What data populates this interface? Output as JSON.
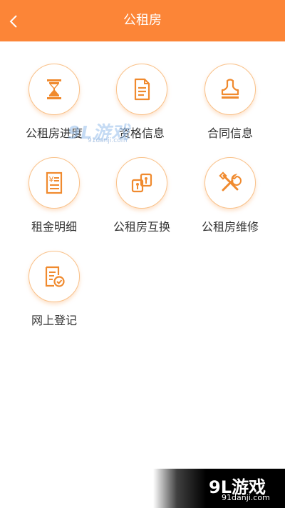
{
  "header": {
    "title": "公租房",
    "back_icon": "chevron-left-icon",
    "background": "#fc8537"
  },
  "grid": {
    "items": [
      {
        "label": "公租房进度",
        "icon": "hourglass-icon"
      },
      {
        "label": "资格信息",
        "icon": "document-icon"
      },
      {
        "label": "合同信息",
        "icon": "stamp-icon"
      },
      {
        "label": "租金明细",
        "icon": "receipt-yuan-icon"
      },
      {
        "label": "公租房互换",
        "icon": "exchange-icon"
      },
      {
        "label": "公租房维修",
        "icon": "repair-tools-icon"
      },
      {
        "label": "网上登记",
        "icon": "register-check-icon"
      }
    ],
    "accent": "#f08a2e",
    "label_color": "#333333"
  },
  "watermark": {
    "center_brand": "9L游戏",
    "center_url": "91danji.com",
    "corner_brand": "9L游戏",
    "corner_url": "91danji.com"
  }
}
